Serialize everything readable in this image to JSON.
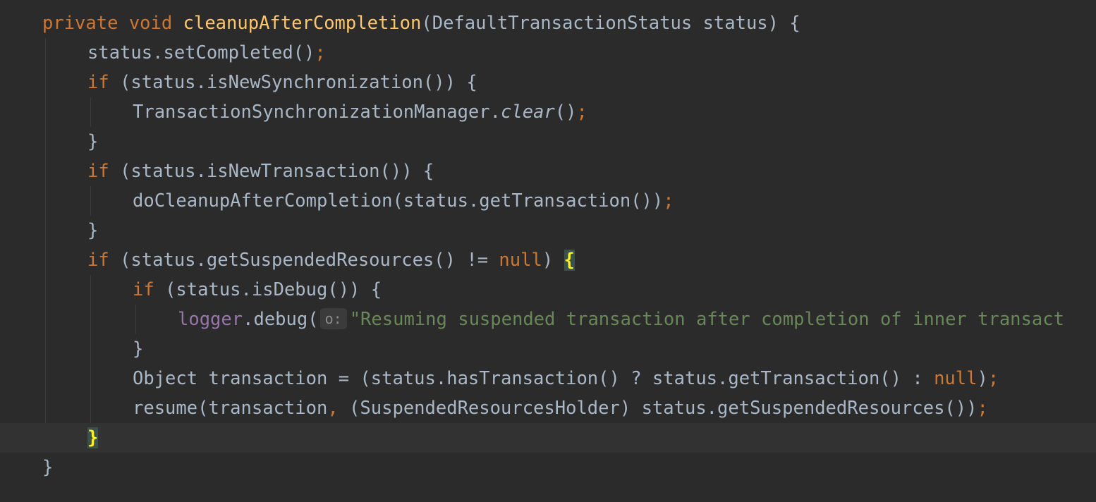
{
  "editor": {
    "language": "Java",
    "colors": {
      "background": "#2b2b2b",
      "current_line": "#323232",
      "keyword": "#cc7832",
      "method_declaration": "#ffc66d",
      "field": "#9876aa",
      "string": "#6a8759",
      "default_text": "#a9b7c6",
      "brace_match": "#ffef28"
    },
    "lines": [
      {
        "kw_private": "private",
        "kw_void": "void",
        "method_name": "cleanupAfterCompletion",
        "params": "(DefaultTransactionStatus status) {"
      },
      {
        "text": "status.setCompleted()",
        "semicolon": ";"
      },
      {
        "kw_if": "if",
        "text": " (status.isNewSynchronization()) {"
      },
      {
        "text_a": "TransactionSynchronizationManager.",
        "italic": "clear",
        "text_b": "()",
        "semicolon": ";"
      },
      {
        "text": "}"
      },
      {
        "kw_if": "if",
        "text": " (status.isNewTransaction()) {"
      },
      {
        "text": "doCleanupAfterCompletion(status.getTransaction())",
        "semicolon": ";"
      },
      {
        "text": "}"
      },
      {
        "kw_if": "if",
        "text_a": " (status.getSuspendedResources() != ",
        "kw_null": "null",
        "text_b": ") ",
        "brace": "{"
      },
      {
        "kw_if": "if",
        "text": " (status.isDebug()) {"
      },
      {
        "field": "logger",
        "text": ".debug(",
        "hint": "o:",
        "string": "\"Resuming suspended transaction after completion of inner transact"
      },
      {
        "text": "}"
      },
      {
        "text_a": "Object transaction = (status.hasTransaction() ? status.getTransaction() : ",
        "kw_null": "null",
        "text_b": ")",
        "semicolon": ";"
      },
      {
        "text_a": "resume(transaction",
        "comma": ",",
        "text_b": " (SuspendedResourcesHolder) status.getSuspendedResources())",
        "semicolon": ";"
      },
      {
        "brace": "}"
      },
      {
        "text": "}"
      }
    ],
    "fold_top_text": "  }"
  }
}
